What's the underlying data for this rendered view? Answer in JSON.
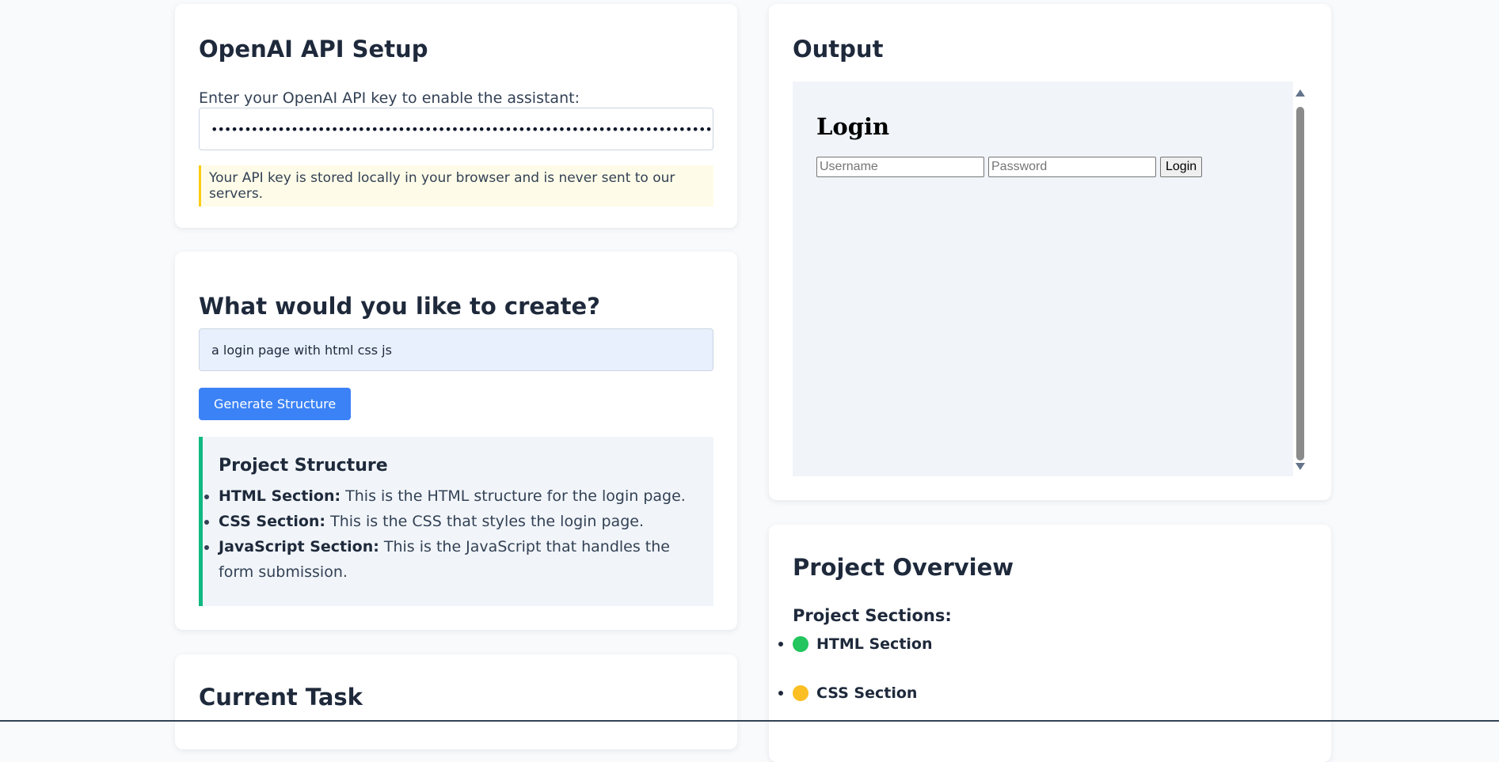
{
  "api_setup": {
    "title": "OpenAI API Setup",
    "label": "Enter your OpenAI API key to enable the assistant:",
    "masked_value": "••••••••••••••••••••••••••••••••••••••••••••••••••••••••••••••••••••••••••••••••••••••••••••",
    "note": "Your API key is stored locally in your browser and is never sent to our servers.",
    "note_accent": "#facc15"
  },
  "create": {
    "title": "What would you like to create?",
    "prompt_value": "a login page with html css js",
    "generate_label": "Generate Structure",
    "button_color": "#3b82f6",
    "structure": {
      "title": "Project Structure",
      "accent": "#10b981",
      "items": [
        {
          "name": "HTML Section:",
          "desc": " This is the HTML structure for the login page."
        },
        {
          "name": "CSS Section:",
          "desc": " This is the CSS that styles the login page."
        },
        {
          "name": "JavaScript Section:",
          "desc": " This is the JavaScript that handles the form submission."
        }
      ]
    }
  },
  "current_task": {
    "title": "Current Task"
  },
  "output": {
    "title": "Output",
    "preview": {
      "heading": "Login",
      "username_placeholder": "Username",
      "password_placeholder": "Password",
      "login_label": "Login"
    }
  },
  "overview": {
    "title": "Project Overview",
    "subtitle": "Project Sections:",
    "sections": [
      {
        "label": "HTML Section",
        "status_color": "#22c55e"
      },
      {
        "label": "CSS Section",
        "status_color": "#fbbf24"
      }
    ]
  }
}
